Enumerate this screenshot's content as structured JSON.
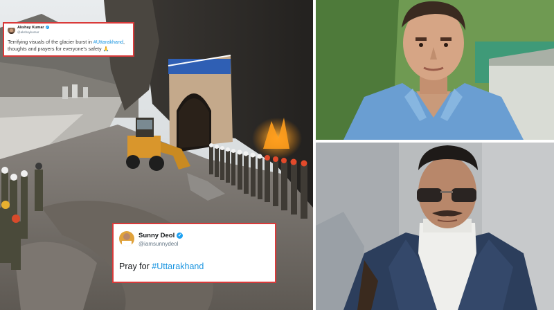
{
  "tweets": [
    {
      "name": "Akshay Kumar",
      "handle": "@akshaykumar",
      "text_before": "Terrifying visuals of the glacier burst in ",
      "hashtag": "#Uttarakhand",
      "text_after": ", thoughts and prayers for everyone's safety 🙏"
    },
    {
      "name": "Sunny Deol",
      "handle": "@iamsunnydeol",
      "text_before": "Pray for ",
      "hashtag": "#Uttarakhand",
      "text_after": ""
    }
  ],
  "colors": {
    "tweet_border": "#d93a3a",
    "hashtag": "#1b95e0",
    "verified": "#1da1f2"
  }
}
